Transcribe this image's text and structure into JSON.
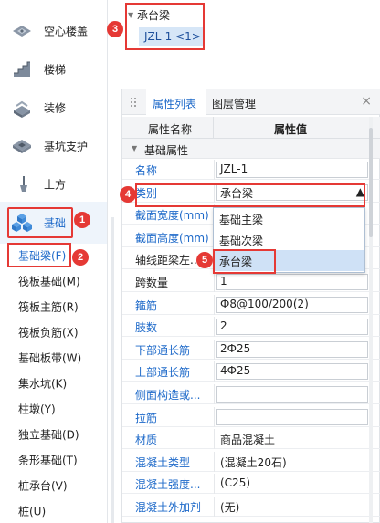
{
  "sidebar": {
    "categories": [
      {
        "label": "空心楼盖",
        "icon": "hollow-floor-icon"
      },
      {
        "label": "楼梯",
        "icon": "stairs-icon"
      },
      {
        "label": "装修",
        "icon": "decoration-icon"
      },
      {
        "label": "基坑支护",
        "icon": "pit-support-icon"
      },
      {
        "label": "土方",
        "icon": "earthwork-icon"
      },
      {
        "label": "基础",
        "icon": "foundation-icon",
        "active": true
      }
    ],
    "sub_items": [
      {
        "label": "基础梁(F)",
        "active": true
      },
      {
        "label": "筏板基础(M)"
      },
      {
        "label": "筏板主筋(R)"
      },
      {
        "label": "筏板负筋(X)"
      },
      {
        "label": "基础板带(W)"
      },
      {
        "label": "集水坑(K)"
      },
      {
        "label": "柱墩(Y)"
      },
      {
        "label": "独立基础(D)"
      },
      {
        "label": "条形基础(T)"
      },
      {
        "label": "桩承台(V)"
      },
      {
        "label": "桩(U)"
      }
    ]
  },
  "tree": {
    "root": "承台梁",
    "child": "JZL-1 <1>"
  },
  "panel": {
    "tab_properties": "属性列表",
    "tab_layers": "图层管理",
    "close": "×",
    "col_name": "属性名称",
    "col_value": "属性值",
    "group": "基础属性",
    "rows": [
      {
        "name": "名称",
        "value": "JZL-1",
        "blue": true,
        "boxed": true
      },
      {
        "name": "类别",
        "value": "承台梁",
        "blue": true,
        "boxed": true
      },
      {
        "name": "截面宽度(mm)",
        "value": "",
        "blue": true,
        "boxed": false
      },
      {
        "name": "截面高度(mm)",
        "value": "",
        "blue": true,
        "boxed": false
      },
      {
        "name": "轴线距梁左...",
        "value": "",
        "blue": false,
        "boxed": false
      },
      {
        "name": "跨数量",
        "value": "1",
        "blue": false,
        "boxed": true
      },
      {
        "name": "箍筋",
        "value": "Ф8@100/200(2)",
        "blue": true,
        "boxed": true
      },
      {
        "name": "肢数",
        "value": "2",
        "blue": true,
        "boxed": true
      },
      {
        "name": "下部通长筋",
        "value": "2Ф25",
        "blue": true,
        "boxed": true
      },
      {
        "name": "上部通长筋",
        "value": "4Ф25",
        "blue": true,
        "boxed": true
      },
      {
        "name": "侧面构造或...",
        "value": "",
        "blue": true,
        "boxed": true
      },
      {
        "name": "拉筋",
        "value": "",
        "blue": true,
        "boxed": true
      },
      {
        "name": "材质",
        "value": "商品混凝土",
        "blue": true,
        "boxed": false
      },
      {
        "name": "混凝土类型",
        "value": "(混凝土20石)",
        "blue": true,
        "boxed": false
      },
      {
        "name": "混凝土强度...",
        "value": "(C25)",
        "blue": true,
        "boxed": false
      },
      {
        "name": "混凝土外加剂",
        "value": "(无)",
        "blue": true,
        "boxed": false
      }
    ]
  },
  "dropdown": {
    "options": [
      "基础主梁",
      "基础次梁",
      "承台梁"
    ],
    "selected": "承台梁"
  },
  "badges": [
    "1",
    "2",
    "3",
    "4",
    "5"
  ],
  "colors": {
    "accent": "#1d69c9",
    "highlight": "#e53935",
    "selection": "#cfe1f6"
  }
}
